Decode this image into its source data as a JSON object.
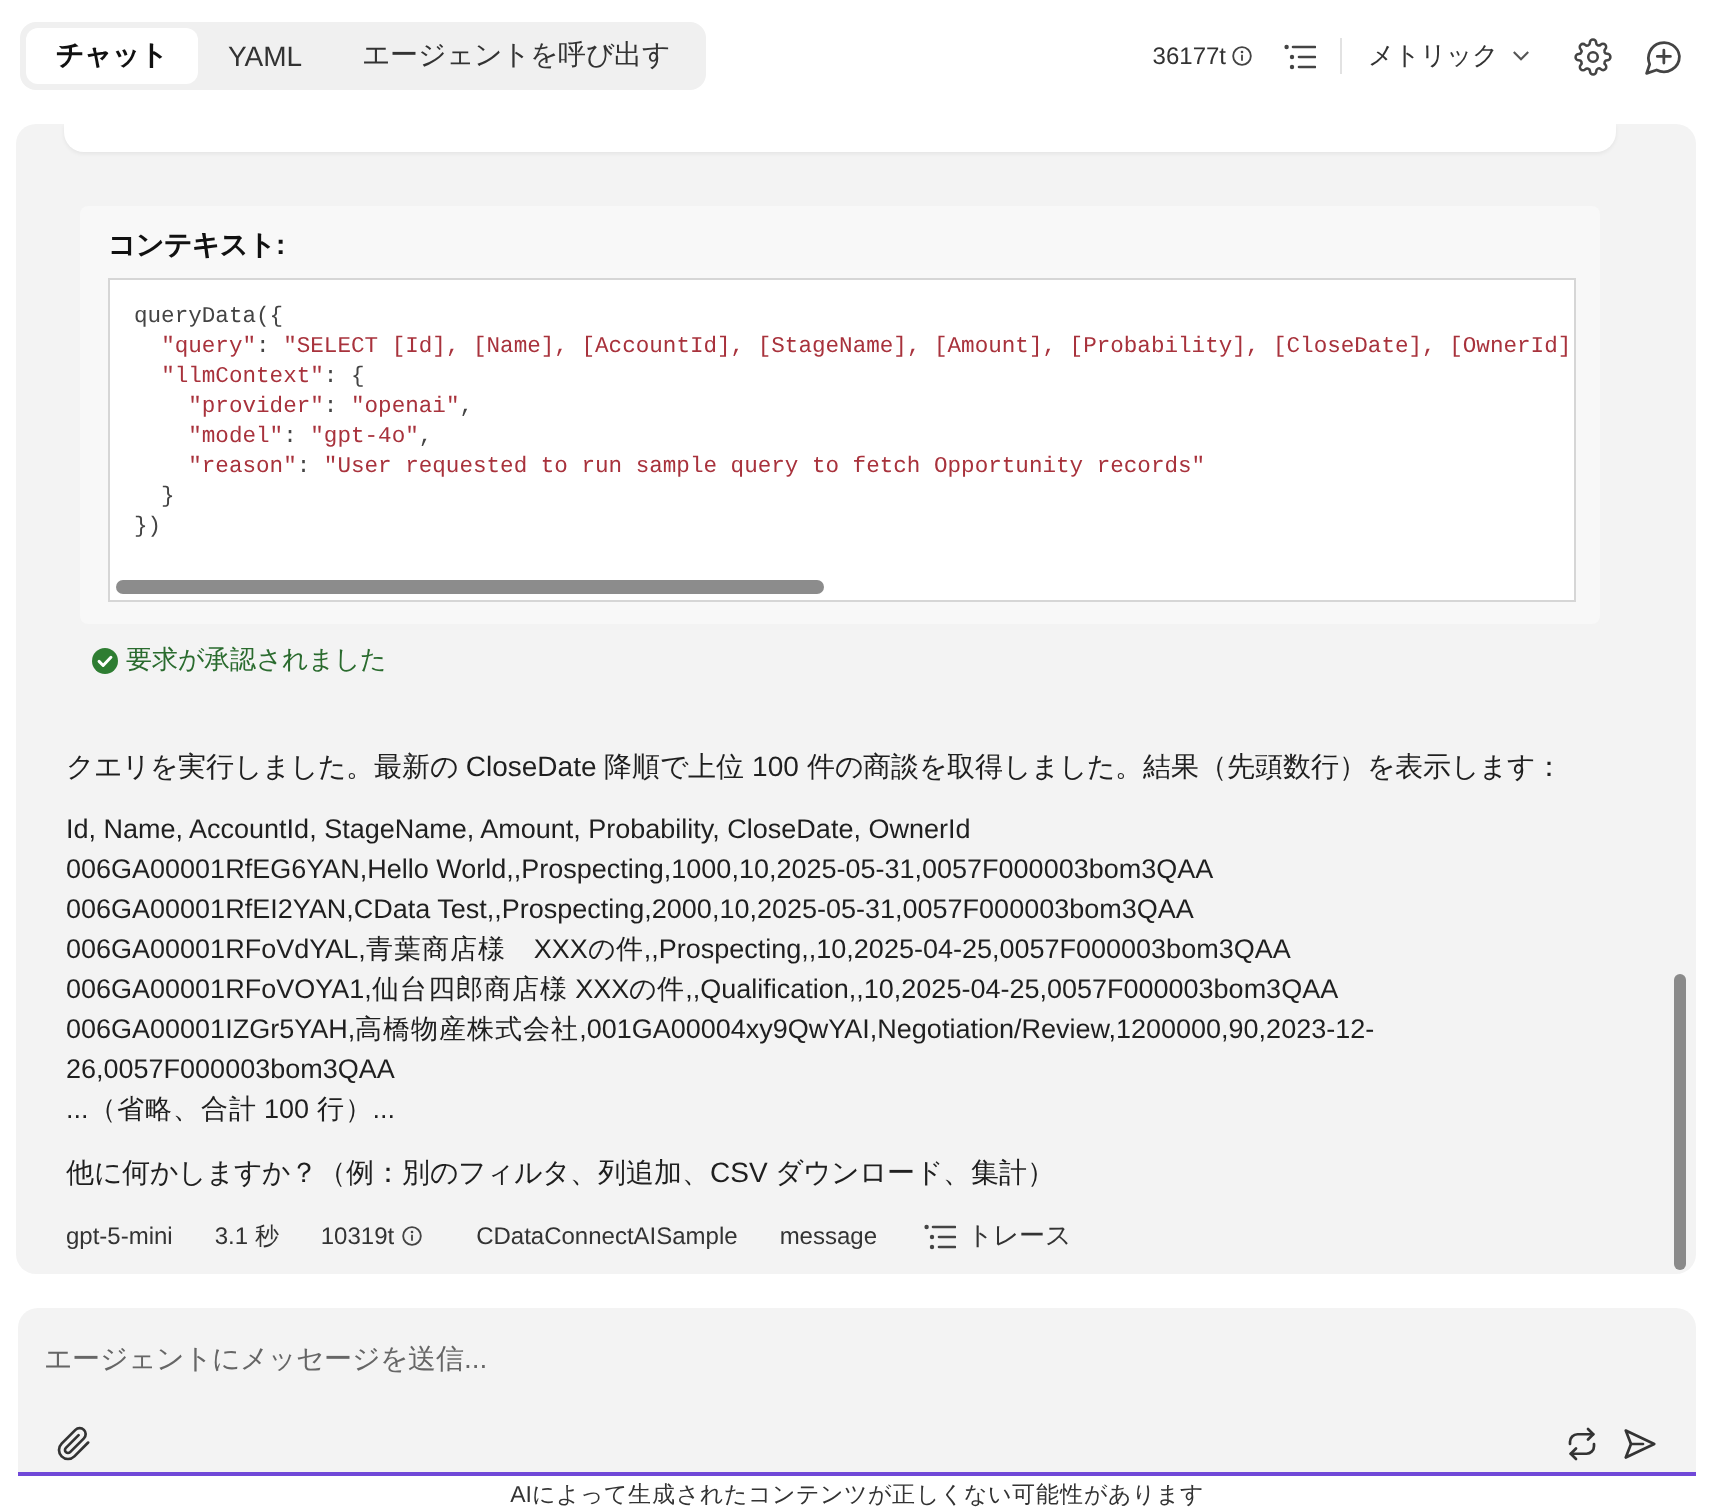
{
  "tabs": [
    {
      "label": "チャット",
      "selected": true
    },
    {
      "label": "YAML",
      "selected": false
    },
    {
      "label": "エージェントを呼び出す",
      "selected": false
    }
  ],
  "toolbar": {
    "token_count": "36177t",
    "metrics_menu": "メトリック"
  },
  "context": {
    "title": "コンテキスト:",
    "code_lines": [
      "queryData({",
      "  \"query\": \"SELECT [Id], [Name], [AccountId], [StageName], [Amount], [Probability], [CloseDate], [OwnerId]",
      "  \"llmContext\": {",
      "    \"provider\": \"openai\",",
      "    \"model\": \"gpt-4o\",",
      "    \"reason\": \"User requested to run sample query to fetch Opportunity records\"",
      "  }",
      "})"
    ]
  },
  "approval": {
    "text": "要求が承認されました"
  },
  "message": {
    "intro": "クエリを実行しました。最新の CloseDate 降順で上位 100 件の商談を取得しました。結果（先頭数行）を表示します：",
    "data_lines": [
      "Id, Name, AccountId, StageName, Amount, Probability, CloseDate, OwnerId",
      "006GA00001RfEG6YAN,Hello World,,Prospecting,1000,10,2025-05-31,0057F000003bom3QAA",
      "006GA00001RfEI2YAN,CData Test,,Prospecting,2000,10,2025-05-31,0057F000003bom3QAA",
      "006GA00001RFoVdYAL,青葉商店様　XXXの件,,Prospecting,,10,2025-04-25,0057F000003bom3QAA",
      "006GA00001RFoVOYA1,仙台四郎商店様 XXXの件,,Qualification,,10,2025-04-25,0057F000003bom3QAA",
      "006GA00001IZGr5YAH,高橋物産株式会社,001GA00004xy9QwYAI,Negotiation/Review,1200000,90,2023-12-",
      "26,0057F000003bom3QAA",
      "...（省略、合計 100 行）..."
    ],
    "closing": "他に何かしますか？（例：別のフィルタ、列追加、CSV ダウンロード、集計）",
    "meta": {
      "model": "gpt-5-mini",
      "duration": "3.1 秒",
      "tokens": "10319t",
      "source": "CDataConnectAISample",
      "type": "message",
      "trace": "トレース"
    }
  },
  "composer": {
    "placeholder": "エージェントにメッセージを送信..."
  },
  "disclaimer": "AIによって生成されたコンテンツが正しくない可能性があります"
}
